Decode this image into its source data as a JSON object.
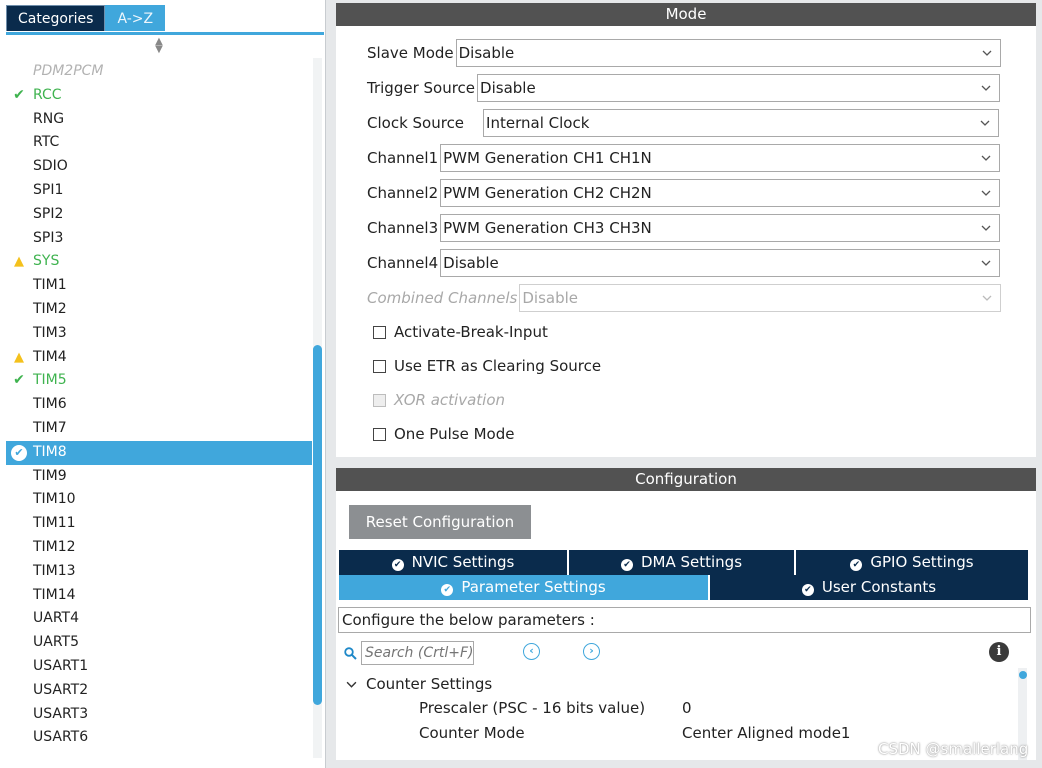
{
  "left_panel": {
    "tabs": [
      {
        "label": "Categories"
      },
      {
        "label": "A->Z"
      }
    ],
    "items": [
      {
        "label": "PDM2PCM",
        "status": "disabled"
      },
      {
        "label": "RCC",
        "status": "ok"
      },
      {
        "label": "RNG",
        "status": ""
      },
      {
        "label": "RTC",
        "status": ""
      },
      {
        "label": "SDIO",
        "status": ""
      },
      {
        "label": "SPI1",
        "status": ""
      },
      {
        "label": "SPI2",
        "status": ""
      },
      {
        "label": "SPI3",
        "status": ""
      },
      {
        "label": "SYS",
        "status": "warning-green"
      },
      {
        "label": "TIM1",
        "status": ""
      },
      {
        "label": "TIM2",
        "status": ""
      },
      {
        "label": "TIM3",
        "status": ""
      },
      {
        "label": "TIM4",
        "status": "warning"
      },
      {
        "label": "TIM5",
        "status": "ok"
      },
      {
        "label": "TIM6",
        "status": ""
      },
      {
        "label": "TIM7",
        "status": ""
      },
      {
        "label": "TIM8",
        "status": "selected"
      },
      {
        "label": "TIM9",
        "status": ""
      },
      {
        "label": "TIM10",
        "status": ""
      },
      {
        "label": "TIM11",
        "status": ""
      },
      {
        "label": "TIM12",
        "status": ""
      },
      {
        "label": "TIM13",
        "status": ""
      },
      {
        "label": "TIM14",
        "status": ""
      },
      {
        "label": "UART4",
        "status": ""
      },
      {
        "label": "UART5",
        "status": ""
      },
      {
        "label": "USART1",
        "status": ""
      },
      {
        "label": "USART2",
        "status": ""
      },
      {
        "label": "USART3",
        "status": ""
      },
      {
        "label": "USART6",
        "status": ""
      }
    ]
  },
  "mode": {
    "title": "Mode",
    "fields": [
      {
        "label": "Slave Mode",
        "value": "Disable"
      },
      {
        "label": "Trigger Source",
        "value": "Disable"
      },
      {
        "label": "Clock Source",
        "value": "Internal Clock"
      },
      {
        "label": "Channel1",
        "value": "PWM Generation CH1 CH1N"
      },
      {
        "label": "Channel2",
        "value": "PWM Generation CH2 CH2N"
      },
      {
        "label": "Channel3",
        "value": "PWM Generation CH3 CH3N"
      },
      {
        "label": "Channel4",
        "value": "Disable"
      },
      {
        "label": "Combined Channels",
        "value": "Disable"
      }
    ],
    "checkboxes": [
      {
        "label": "Activate-Break-Input"
      },
      {
        "label": "Use ETR as Clearing Source"
      },
      {
        "label": "XOR activation"
      },
      {
        "label": "One Pulse Mode"
      }
    ]
  },
  "config": {
    "title": "Configuration",
    "reset_label": "Reset Configuration",
    "tabs": [
      {
        "label": "NVIC Settings"
      },
      {
        "label": "DMA Settings"
      },
      {
        "label": "GPIO Settings"
      },
      {
        "label": "Parameter Settings"
      },
      {
        "label": "User Constants"
      }
    ],
    "description": "Configure the below parameters :",
    "search_placeholder": "Search (Crtl+F)",
    "group_label": "Counter Settings",
    "params": [
      {
        "label": "Prescaler (PSC - 16 bits value)",
        "value": "0"
      },
      {
        "label": "Counter Mode",
        "value": "Center Aligned mode1"
      }
    ]
  },
  "watermark": "CSDN @smallerlang",
  "colors": {
    "accent": "#40a7dc",
    "navy": "#0a2b4c",
    "ok": "#3fb34f",
    "warning": "#f4c11c"
  }
}
